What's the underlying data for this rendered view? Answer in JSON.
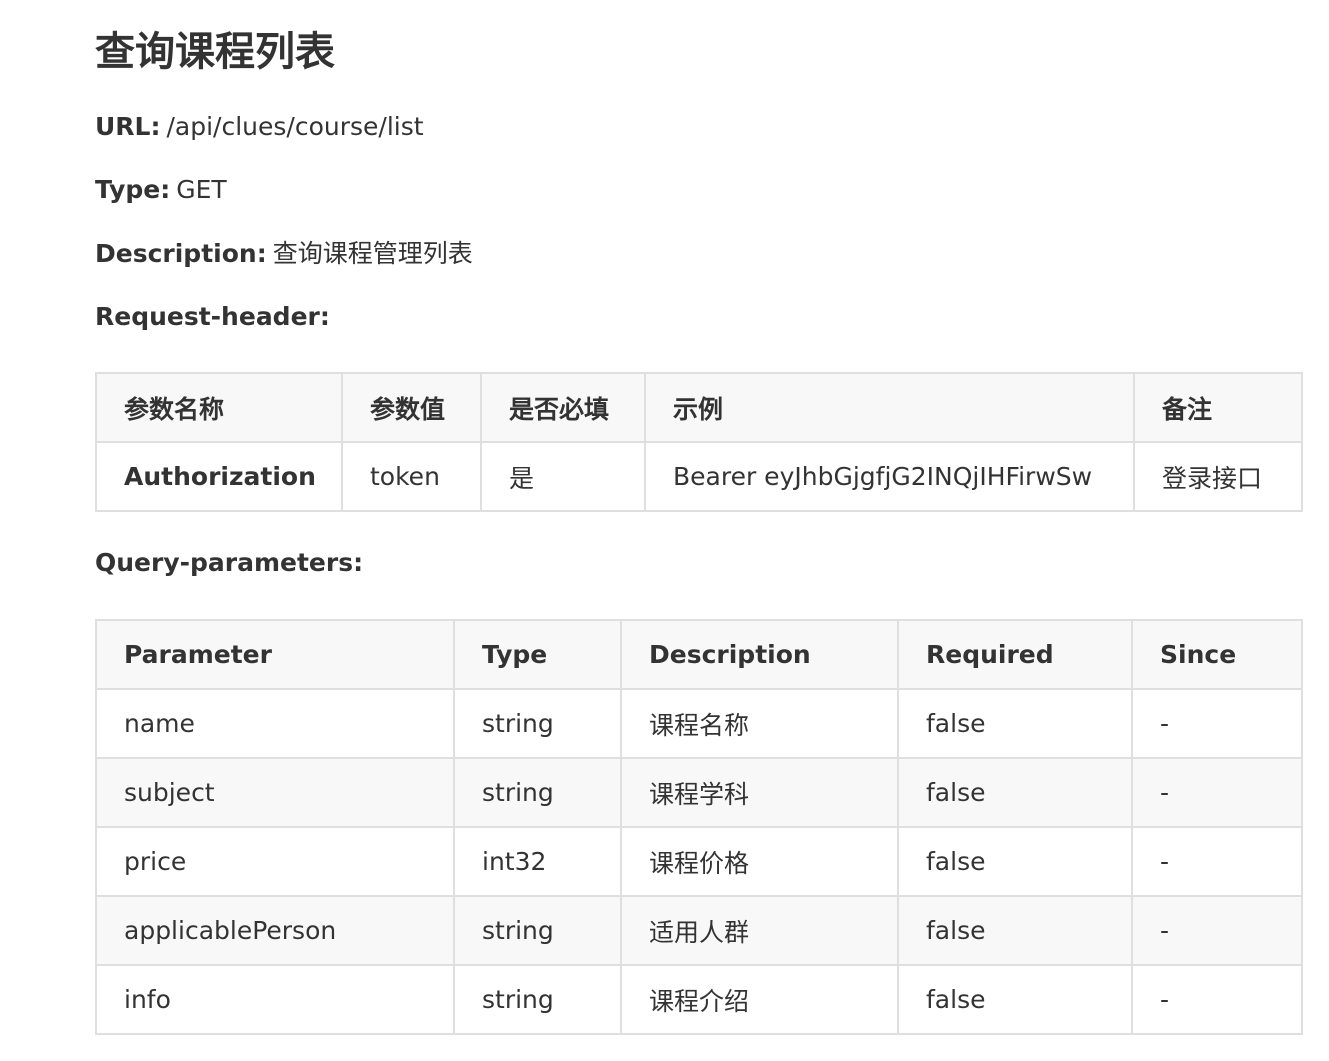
{
  "page": {
    "title": "查询课程列表"
  },
  "meta": {
    "url_label": "URL:",
    "url_value": "/api/clues/course/list",
    "type_label": "Type:",
    "type_value": "GET",
    "description_label": "Description:",
    "description_value": "查询课程管理列表",
    "request_header_label": "Request-header:",
    "query_parameters_label": "Query-parameters:"
  },
  "request_header_table": {
    "headers": [
      "参数名称",
      "参数值",
      "是否必填",
      "示例",
      "备注"
    ],
    "rows": [
      [
        "Authorization",
        "token",
        "是",
        "Bearer eyJhbGjgfjG2INQjIHFirwSw",
        "登录接口"
      ]
    ]
  },
  "query_table": {
    "headers": [
      "Parameter",
      "Type",
      "Description",
      "Required",
      "Since"
    ],
    "rows": [
      [
        "name",
        "string",
        "课程名称",
        "false",
        "-"
      ],
      [
        "subject",
        "string",
        "课程学科",
        "false",
        "-"
      ],
      [
        "price",
        "int32",
        "课程价格",
        "false",
        "-"
      ],
      [
        "applicablePerson",
        "string",
        "适用人群",
        "false",
        "-"
      ],
      [
        "info",
        "string",
        "课程介绍",
        "false",
        "-"
      ]
    ]
  },
  "colors": {
    "text": "#333333",
    "border": "#dfdfdf",
    "header_bg": "#f8f8f8",
    "stripe_bg": "#f8f8f8"
  }
}
